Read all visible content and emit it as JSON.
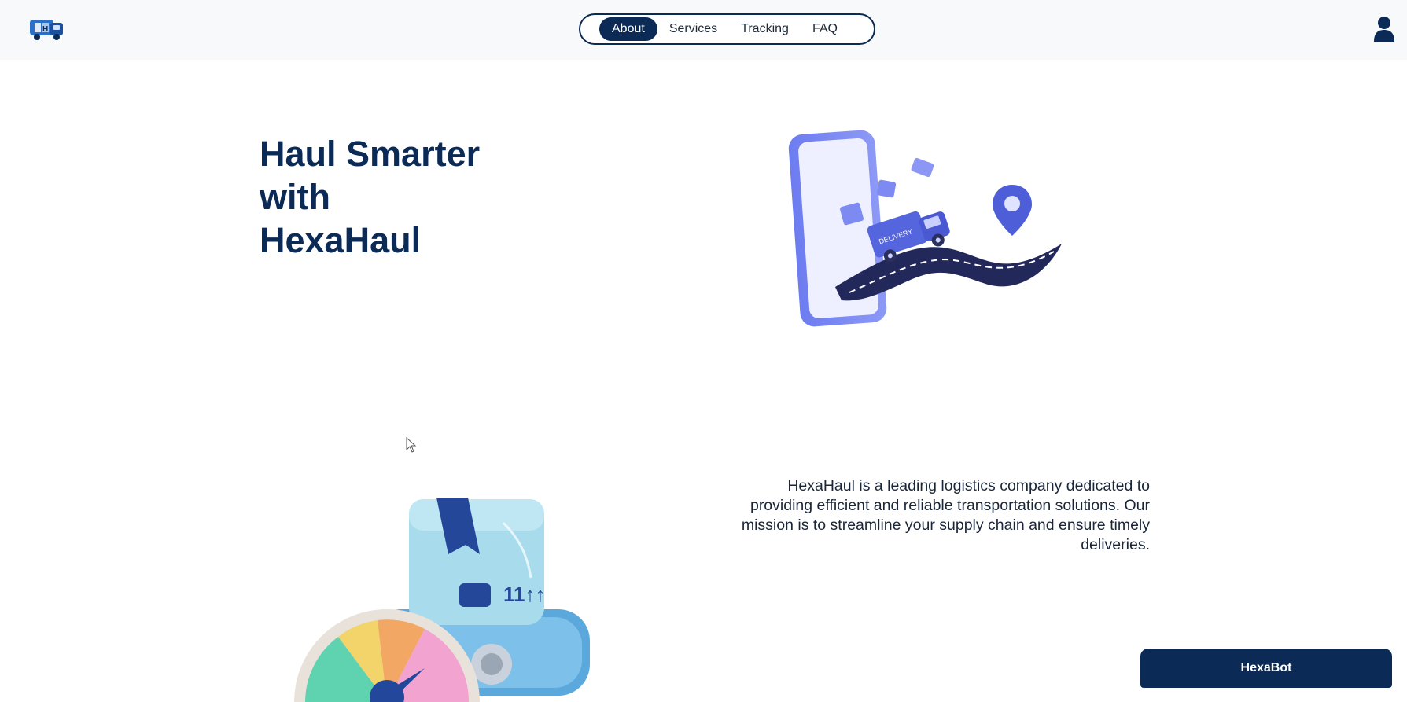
{
  "header": {
    "logo_icon": "truck-logo-icon",
    "nav": [
      {
        "label": "About",
        "active": true
      },
      {
        "label": "Services",
        "active": false
      },
      {
        "label": "Tracking",
        "active": false
      },
      {
        "label": "FAQ",
        "active": false
      }
    ],
    "user_icon": "user-icon"
  },
  "hero": {
    "title_lines": [
      "Haul Smarter",
      "with",
      "HexaHaul"
    ]
  },
  "about": {
    "text": "HexaHaul is a leading logistics company dedicated to providing efficient and reliable transportation solutions. Our mission is to streamline your supply chain and ensure timely deliveries."
  },
  "chat": {
    "label": "HexaBot"
  },
  "colors": {
    "brand_navy": "#0b2a55",
    "accent_blue": "#5b6fe0",
    "header_bg": "#f8f9fb"
  }
}
